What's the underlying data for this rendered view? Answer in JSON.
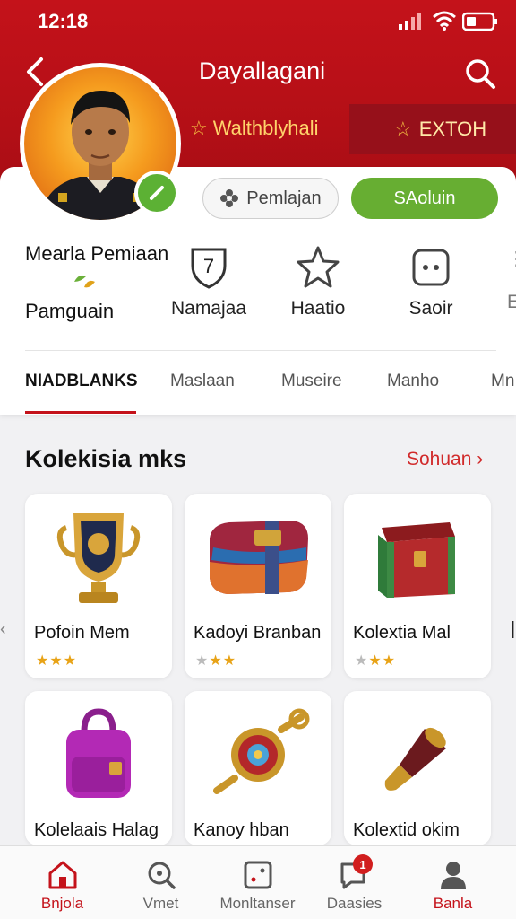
{
  "status": {
    "time": "12:18"
  },
  "header": {
    "title": "Dayallagani",
    "ribbon_left": "Walthblyhali",
    "ribbon_right": "EXTOH"
  },
  "profile": {
    "follow_button": "Pemlajan",
    "action_button": "SAoluin",
    "name": "Mearla Pemiaan",
    "subtitle": "Pamguain",
    "stats": [
      {
        "icon": "shield-number-icon",
        "badge_number": "7",
        "label": "Namajaa"
      },
      {
        "icon": "star-outline-icon",
        "label": "Haatio"
      },
      {
        "icon": "dice-icon",
        "label": "Saoir"
      }
    ]
  },
  "tabs": [
    {
      "label": "NIADBLANKS",
      "active": true
    },
    {
      "label": "Maslaan"
    },
    {
      "label": "Museire"
    },
    {
      "label": "Manho"
    },
    {
      "label": "Mn"
    }
  ],
  "collection": {
    "title": "Kolekisia mks",
    "see_all": "Sohuan",
    "items": [
      {
        "name": "Pofoin Mem",
        "icon": "trophy-icon",
        "rating": 3,
        "max_rating": 3
      },
      {
        "name": "Kadoyi Branban",
        "icon": "gift-box-icon",
        "rating": 2,
        "max_rating": 3
      },
      {
        "name": "Kolextia Mal",
        "icon": "treasure-chest-icon",
        "rating": 2,
        "max_rating": 3
      },
      {
        "name": "Kolelaais Halag",
        "icon": "backpack-icon"
      },
      {
        "name": "Kanoy hban",
        "icon": "amulet-icon"
      },
      {
        "name": "Kolextid okim",
        "icon": "horn-icon"
      }
    ]
  },
  "bottom_nav": [
    {
      "label": "Bnjola",
      "icon": "home-icon",
      "active": true
    },
    {
      "label": "Vmet",
      "icon": "search-icon"
    },
    {
      "label": "Monltanser",
      "icon": "dice-icon"
    },
    {
      "label": "Daasies",
      "icon": "chat-icon",
      "badge": "1"
    },
    {
      "label": "Banla",
      "icon": "person-icon"
    }
  ],
  "colors": {
    "brand_red": "#c4121a",
    "action_green": "#67ae32",
    "star_gold": "#e8a317"
  }
}
